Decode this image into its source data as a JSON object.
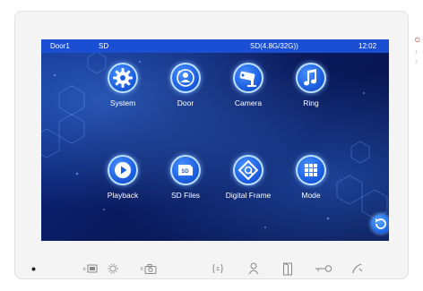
{
  "status_bar": {
    "left": "Door1",
    "mode": "SD",
    "storage": "SD(4.8G/32G))",
    "time": "12:02"
  },
  "menu": [
    {
      "label": "System",
      "icon": "gear-icon"
    },
    {
      "label": "Door",
      "icon": "door-icon"
    },
    {
      "label": "Camera",
      "icon": "camera-icon"
    },
    {
      "label": "Ring",
      "icon": "music-note-icon"
    },
    {
      "label": "Playback",
      "icon": "play-icon"
    },
    {
      "label": "SD Files",
      "icon": "sd-card-icon"
    },
    {
      "label": "Digital Frame",
      "icon": "frame-icon"
    },
    {
      "label": "Mode",
      "icon": "grid-icon"
    }
  ],
  "side_indicators": [
    "1",
    "2"
  ],
  "hardware_buttons": {
    "up": "∧",
    "down": "∨"
  },
  "colors": {
    "status_bar": "#1a4fd4",
    "screen_bg": "#0a1a5e",
    "icon_accent": "#1c5fe0",
    "indicator_red": "#d72b2b"
  }
}
